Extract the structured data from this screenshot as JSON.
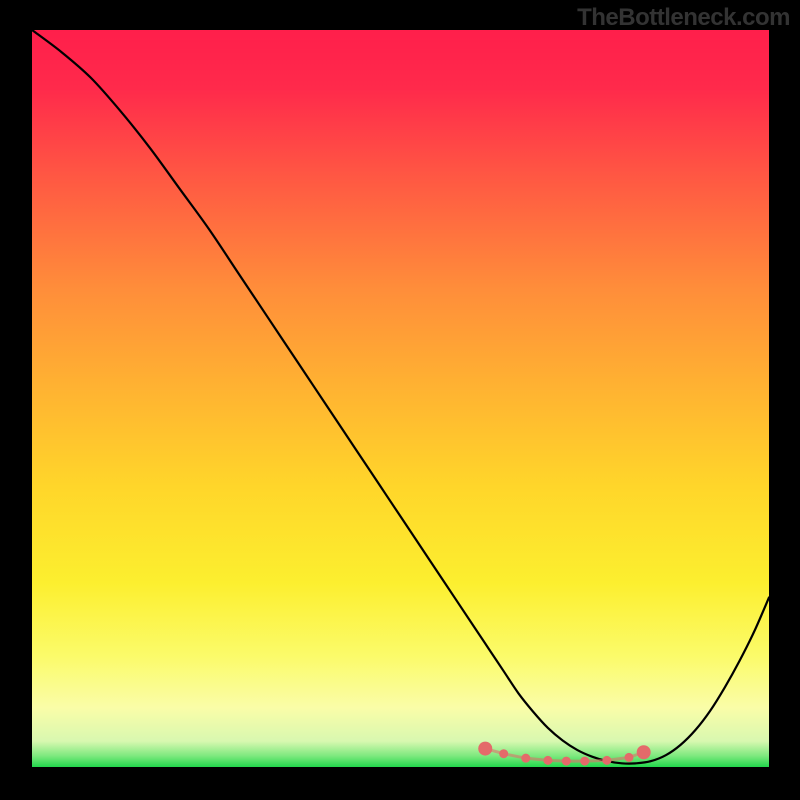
{
  "attribution": "TheBottleneck.com",
  "chart_data": {
    "type": "line",
    "title": "",
    "xlabel": "",
    "ylabel": "",
    "xlim": [
      0,
      100
    ],
    "ylim": [
      0,
      100
    ],
    "background_gradient_stops": [
      {
        "offset": 0.0,
        "color": "#ff1f4b"
      },
      {
        "offset": 0.08,
        "color": "#ff2a4b"
      },
      {
        "offset": 0.2,
        "color": "#ff5843"
      },
      {
        "offset": 0.35,
        "color": "#ff8d3a"
      },
      {
        "offset": 0.48,
        "color": "#ffb132"
      },
      {
        "offset": 0.62,
        "color": "#ffd62a"
      },
      {
        "offset": 0.75,
        "color": "#fcef2f"
      },
      {
        "offset": 0.85,
        "color": "#fbfb6a"
      },
      {
        "offset": 0.92,
        "color": "#fafda8"
      },
      {
        "offset": 0.965,
        "color": "#d8f8b0"
      },
      {
        "offset": 0.985,
        "color": "#7de97e"
      },
      {
        "offset": 1.0,
        "color": "#22d74c"
      }
    ],
    "series": [
      {
        "name": "bottleneck-curve",
        "x": [
          0,
          4,
          8,
          12,
          16,
          20,
          24,
          28,
          32,
          36,
          40,
          44,
          48,
          52,
          56,
          60,
          62,
          64,
          66,
          68,
          70,
          72,
          74,
          76,
          78,
          80,
          82,
          84,
          86,
          88,
          90,
          92,
          94,
          96,
          98,
          100
        ],
        "y": [
          100,
          97,
          93.5,
          89,
          84,
          78.5,
          73,
          67,
          61,
          55,
          49,
          43,
          37,
          31,
          25,
          19,
          16,
          13,
          10,
          7.5,
          5.3,
          3.6,
          2.3,
          1.4,
          0.8,
          0.5,
          0.5,
          0.8,
          1.6,
          3.0,
          5.0,
          7.6,
          10.8,
          14.4,
          18.4,
          23
        ]
      }
    ],
    "markers": {
      "name": "highlight-range",
      "color": "#e46a6a",
      "points_x": [
        61.5,
        64,
        67,
        70,
        72.5,
        75,
        78,
        81,
        83
      ],
      "points_y": [
        2.5,
        1.8,
        1.2,
        0.9,
        0.8,
        0.8,
        0.9,
        1.3,
        2.0
      ]
    }
  }
}
